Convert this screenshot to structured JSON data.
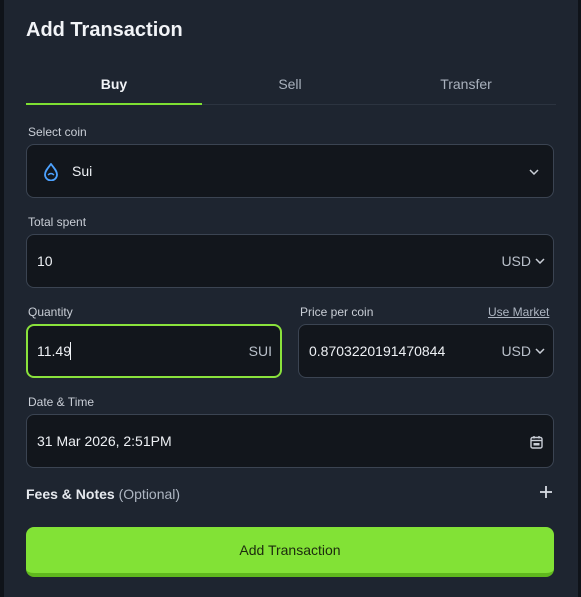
{
  "title": "Add Transaction",
  "tabs": [
    {
      "label": "Buy"
    },
    {
      "label": "Sell"
    },
    {
      "label": "Transfer"
    }
  ],
  "select_coin": {
    "label": "Select coin",
    "value": "Sui"
  },
  "total_spent": {
    "label": "Total spent",
    "value": "10",
    "currency": "USD"
  },
  "quantity": {
    "label": "Quantity",
    "value": "11.49",
    "unit": "SUI"
  },
  "price": {
    "label": "Price per coin",
    "link": "Use Market",
    "value": "0.8703220191470844",
    "currency": "USD"
  },
  "date": {
    "label": "Date & Time",
    "value": "31 Mar 2026, 2:51PM"
  },
  "fees": {
    "label": "Fees & Notes",
    "optional": "(Optional)"
  },
  "submit_label": "Add Transaction",
  "colors": {
    "accent": "#82e236",
    "background": "#1e2530",
    "field": "#12161c",
    "sui_blue": "#4da2ff"
  },
  "icons": {
    "coin": "sui-droplet-icon",
    "calendar": "calendar-icon",
    "add": "plus-icon",
    "dropdown": "chevron-down-icon"
  }
}
